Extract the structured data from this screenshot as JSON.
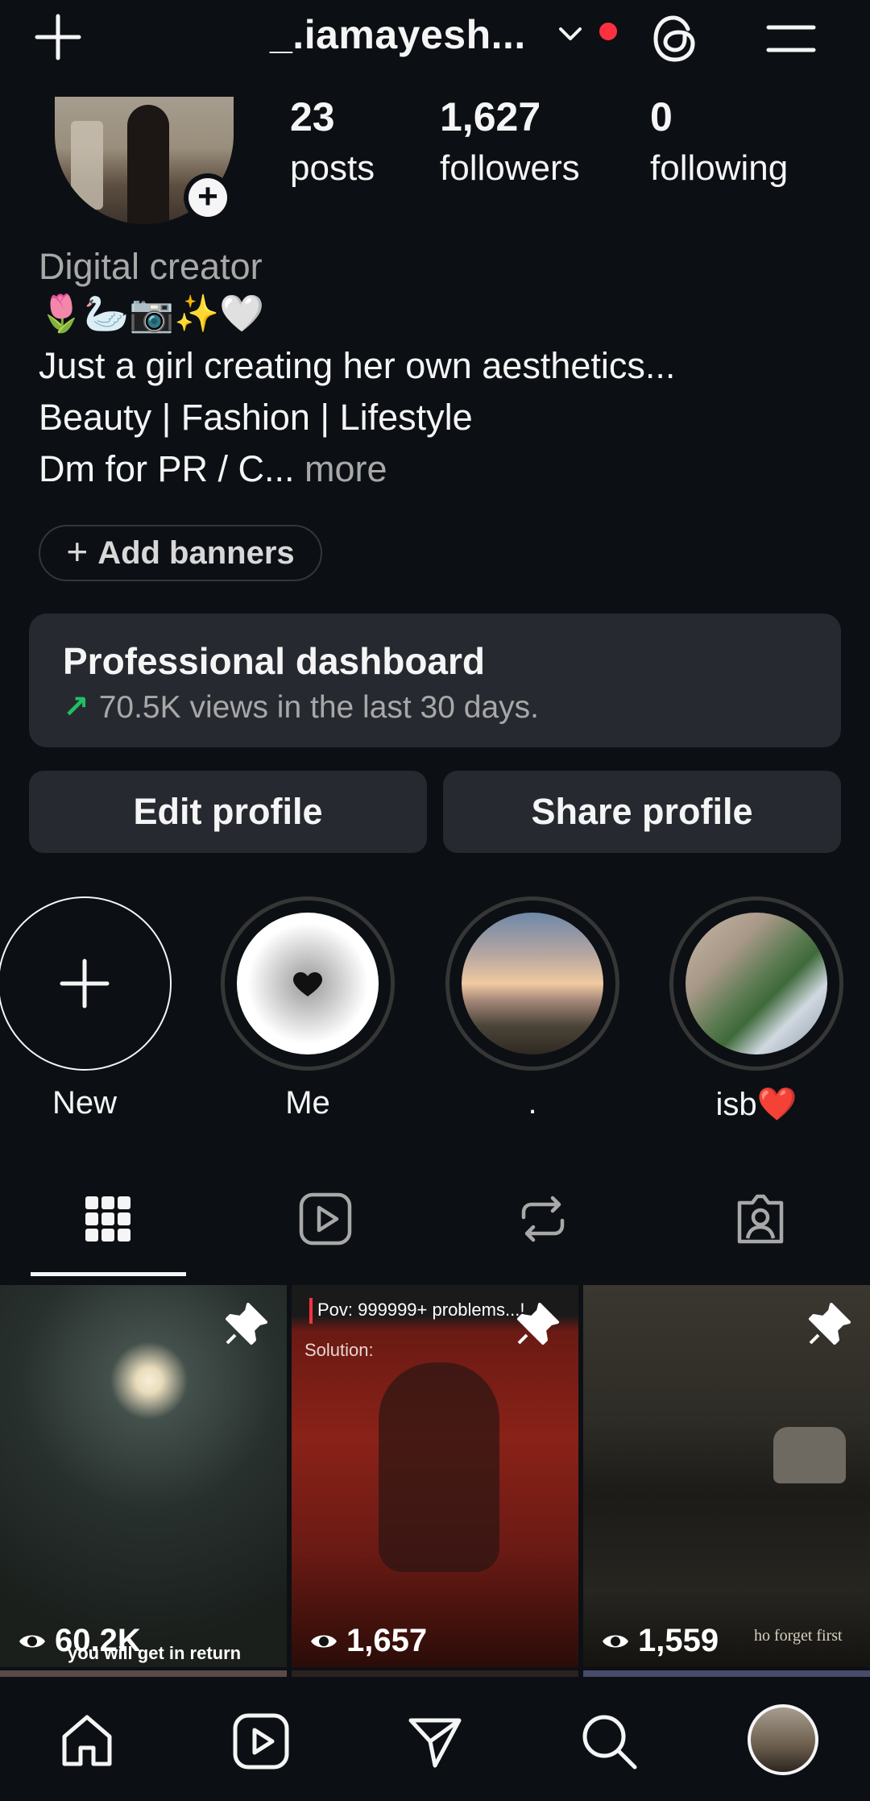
{
  "header": {
    "username": "_.iamayesh...",
    "has_notification_dot": true
  },
  "profile": {
    "stats": [
      {
        "value": "23",
        "label": "posts"
      },
      {
        "value": "1,627",
        "label": "followers"
      },
      {
        "value": "0",
        "label": "following"
      }
    ],
    "category": "Digital creator",
    "bio_emojis": "🌷🦢📷✨🤍",
    "bio_line1": "Just a girl creating her own aesthetics...",
    "bio_line2": "Beauty | Fashion | Lifestyle",
    "bio_line3": "Dm for PR / C...",
    "more_label": "more"
  },
  "add_banners_label": "Add banners",
  "dashboard": {
    "title": "Professional dashboard",
    "subtitle": "70.5K views in the last 30 days."
  },
  "buttons": {
    "edit": "Edit profile",
    "share": "Share profile"
  },
  "highlights": [
    {
      "label": "New"
    },
    {
      "label": "Me"
    },
    {
      "label": "."
    },
    {
      "label": "isb❤️"
    }
  ],
  "tabs": [
    "grid-icon",
    "reels-icon",
    "reposts-icon",
    "tagged-icon"
  ],
  "posts": [
    {
      "views": "60.2K",
      "caption": "you will get in return",
      "pinned": true
    },
    {
      "views": "1,657",
      "overlay_top": "Pov: 999999+ problems...!",
      "overlay_sub": "Solution:",
      "pinned": true
    },
    {
      "views": "1,559",
      "caption": "ho forget first",
      "pinned": true
    }
  ],
  "colors": {
    "background": "#0c1014",
    "card": "#262a30",
    "accent_red": "#ff3040",
    "trend_green": "#21c063",
    "muted_text": "#a8a8a8"
  },
  "bottom_nav": [
    "home-icon",
    "reels-icon",
    "send-icon",
    "search-icon",
    "profile-avatar"
  ]
}
